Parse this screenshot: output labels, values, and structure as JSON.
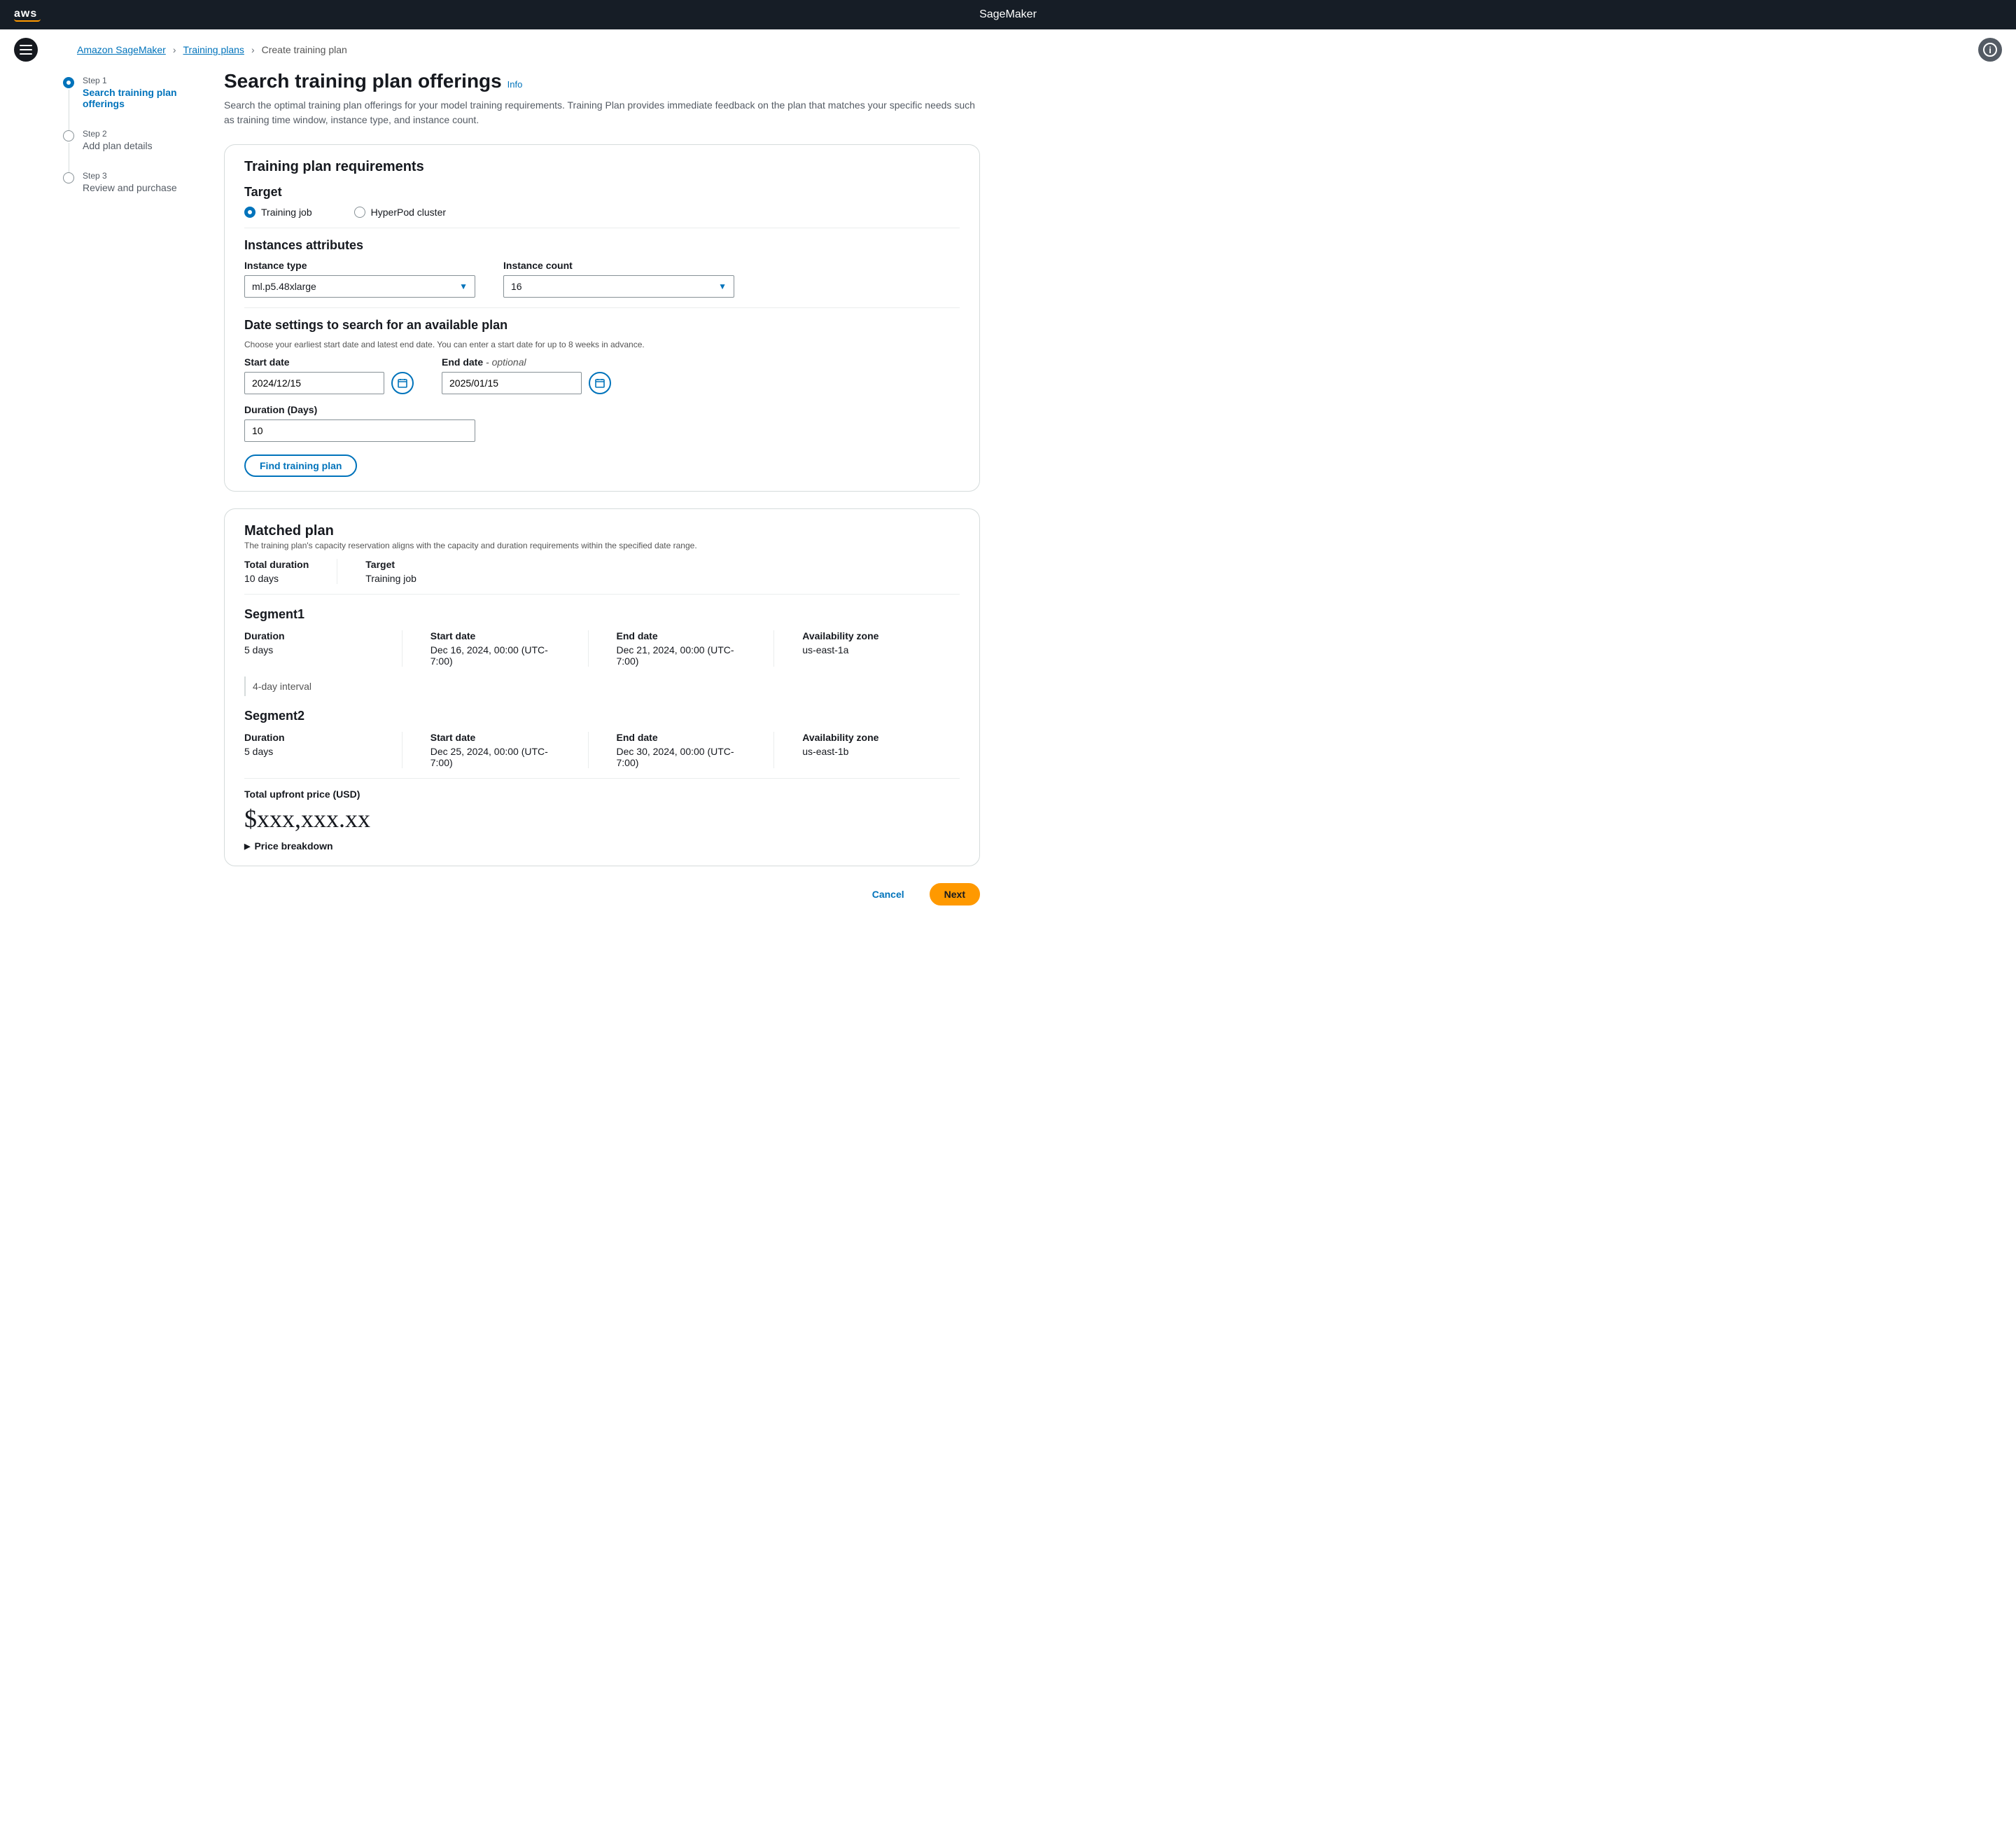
{
  "topbar": {
    "logo": "aws",
    "service": "SageMaker"
  },
  "breadcrumbs": {
    "items": [
      "Amazon SageMaker",
      "Training plans",
      "Create training plan"
    ]
  },
  "wizard": {
    "steps": [
      {
        "label": "Step 1",
        "title": "Search training plan offerings"
      },
      {
        "label": "Step 2",
        "title": "Add plan details"
      },
      {
        "label": "Step 3",
        "title": "Review and purchase"
      }
    ]
  },
  "page": {
    "title": "Search training plan offerings",
    "info": "Info",
    "description": "Search the optimal training plan offerings for your model training requirements. Training Plan provides immediate feedback on the plan that matches your specific needs such as training time window, instance type, and instance count."
  },
  "requirements": {
    "title": "Training plan requirements",
    "target": {
      "heading": "Target",
      "options": [
        "Training job",
        "HyperPod cluster"
      ],
      "selected": "Training job"
    },
    "instances": {
      "heading": "Instances attributes",
      "type_label": "Instance type",
      "type_value": "ml.p5.48xlarge",
      "count_label": "Instance count",
      "count_value": "16"
    },
    "dates": {
      "heading": "Date settings to search for an available plan",
      "helper": "Choose your earliest start date and latest end date. You can enter a start date for up to 8 weeks in advance.",
      "start_label": "Start date",
      "start_value": "2024/12/15",
      "end_label": "End date",
      "end_optional": " - optional",
      "end_value": "2025/01/15",
      "duration_label": "Duration  (Days)",
      "duration_value": "10"
    },
    "find_button": "Find training plan"
  },
  "matched": {
    "title": "Matched plan",
    "subtitle": "The training plan's capacity reservation aligns with the capacity and duration requirements within the specified date range.",
    "total_duration_label": "Total duration",
    "total_duration_value": "10 days",
    "target_label": "Target",
    "target_value": "Training job",
    "segments": [
      {
        "title": "Segment1",
        "duration_label": "Duration",
        "duration_value": "5 days",
        "start_label": "Start date",
        "start_value": "Dec 16, 2024, 00:00 (UTC-7:00)",
        "end_label": "End date",
        "end_value": "Dec 21, 2024, 00:00 (UTC-7:00)",
        "az_label": "Availability zone",
        "az_value": "us-east-1a"
      },
      {
        "title": "Segment2",
        "duration_label": "Duration",
        "duration_value": "5 days",
        "start_label": "Start date",
        "start_value": "Dec 25, 2024, 00:00 (UTC-7:00)",
        "end_label": "End date",
        "end_value": "Dec 30, 2024, 00:00 (UTC-7:00)",
        "az_label": "Availability zone",
        "az_value": "us-east-1b"
      }
    ],
    "interval": "4-day interval",
    "price_label": "Total upfront price (USD)",
    "price_value": "$xxx,xxx.xx",
    "breakdown": "Price breakdown"
  },
  "footer": {
    "cancel": "Cancel",
    "next": "Next"
  }
}
